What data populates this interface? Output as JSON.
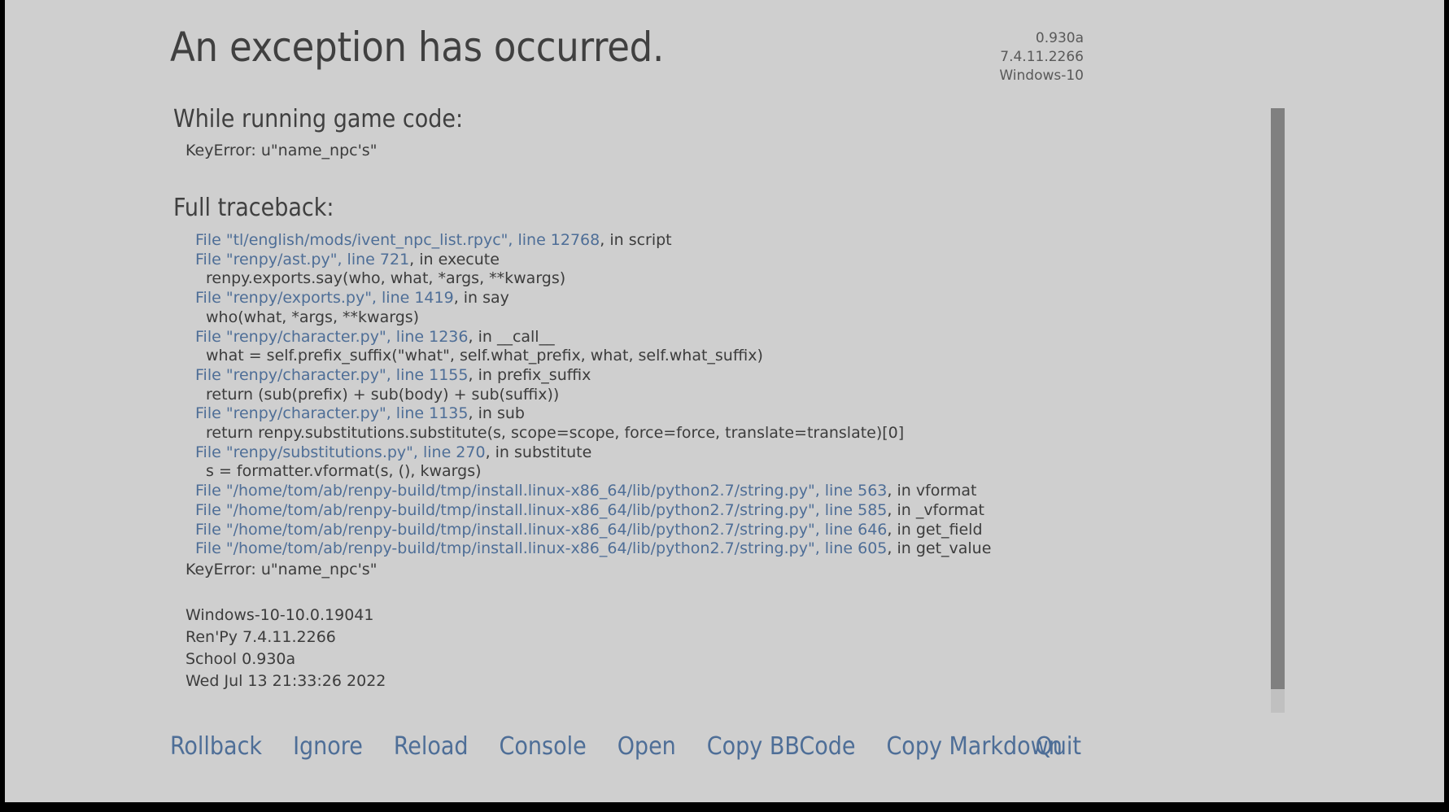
{
  "header": {
    "title": "An exception has occurred.",
    "version": {
      "game_version": "0.930a",
      "engine_version": "7.4.11.2266",
      "platform": "Windows-10"
    }
  },
  "body": {
    "running_heading": "While running game code:",
    "running_error": "KeyError: u\"name_npc's\"",
    "traceback_heading": "Full traceback:",
    "traceback": [
      {
        "kind": "file",
        "link": "File \"tl/english/mods/ivent_npc_list.rpyc\", line 12768",
        "tail": ", in script"
      },
      {
        "kind": "file",
        "link": "File \"renpy/ast.py\", line 721",
        "tail": ", in execute"
      },
      {
        "kind": "source",
        "code": "renpy.exports.say(who, what, *args, **kwargs)"
      },
      {
        "kind": "file",
        "link": "File \"renpy/exports.py\", line 1419",
        "tail": ", in say"
      },
      {
        "kind": "source",
        "code": "who(what, *args, **kwargs)"
      },
      {
        "kind": "file",
        "link": "File \"renpy/character.py\", line 1236",
        "tail": ", in __call__"
      },
      {
        "kind": "source",
        "code": "what = self.prefix_suffix(\"what\", self.what_prefix, what, self.what_suffix)"
      },
      {
        "kind": "file",
        "link": "File \"renpy/character.py\", line 1155",
        "tail": ", in prefix_suffix"
      },
      {
        "kind": "source",
        "code": "return (sub(prefix) + sub(body) + sub(suffix))"
      },
      {
        "kind": "file",
        "link": "File \"renpy/character.py\", line 1135",
        "tail": ", in sub"
      },
      {
        "kind": "source",
        "code": "return renpy.substitutions.substitute(s, scope=scope, force=force, translate=translate)[0]"
      },
      {
        "kind": "file",
        "link": "File \"renpy/substitutions.py\", line 270",
        "tail": ", in substitute"
      },
      {
        "kind": "source",
        "code": "s = formatter.vformat(s, (), kwargs)"
      },
      {
        "kind": "file",
        "link": "File \"/home/tom/ab/renpy-build/tmp/install.linux-x86_64/lib/python2.7/string.py\", line 563",
        "tail": ", in vformat"
      },
      {
        "kind": "file",
        "link": "File \"/home/tom/ab/renpy-build/tmp/install.linux-x86_64/lib/python2.7/string.py\", line 585",
        "tail": ", in _vformat"
      },
      {
        "kind": "file",
        "link": "File \"/home/tom/ab/renpy-build/tmp/install.linux-x86_64/lib/python2.7/string.py\", line 646",
        "tail": ", in get_field"
      },
      {
        "kind": "file",
        "link": "File \"/home/tom/ab/renpy-build/tmp/install.linux-x86_64/lib/python2.7/string.py\", line 605",
        "tail": ", in get_value"
      }
    ],
    "traceback_error": "KeyError: u\"name_npc's\"",
    "system_info": [
      "Windows-10-10.0.19041",
      "Ren'Py 7.4.11.2266",
      "School 0.930a",
      "Wed Jul 13 21:33:26 2022"
    ]
  },
  "footer": {
    "buttons": [
      {
        "label": "Rollback",
        "name": "rollback-button"
      },
      {
        "label": "Ignore",
        "name": "ignore-button"
      },
      {
        "label": "Reload",
        "name": "reload-button"
      },
      {
        "label": "Console",
        "name": "console-button"
      },
      {
        "label": "Open",
        "name": "open-button"
      },
      {
        "label": "Copy BBCode",
        "name": "copy-bbcode-button"
      },
      {
        "label": "Copy Markdown",
        "name": "copy-markdown-button"
      }
    ],
    "quit_label": "Quit"
  },
  "colors": {
    "background": "#cfcfcf",
    "text": "#3c3c3c",
    "heading": "#404040",
    "link": "#4e6e97",
    "scrollbar_thumb": "#808080",
    "scrollbar_track": "#c0c0c0",
    "frame": "#000000"
  }
}
